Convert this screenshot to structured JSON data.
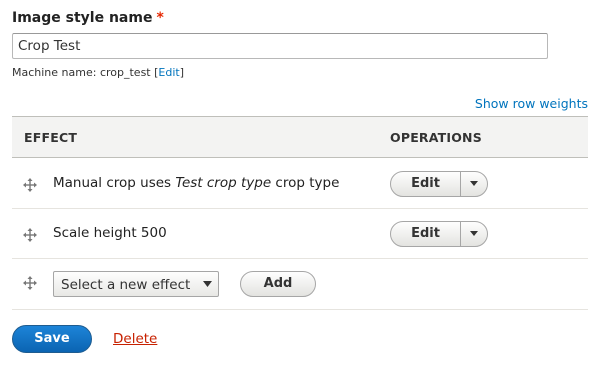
{
  "field": {
    "label": "Image style name",
    "required_mark": "*",
    "value": "Crop Test",
    "machine_name_prefix": "Machine name: crop_test [",
    "machine_name_edit": "Edit",
    "machine_name_suffix": "]"
  },
  "show_row_weights": "Show row weights",
  "table": {
    "headers": {
      "effect": "EFFECT",
      "operations": "OPERATIONS"
    },
    "rows": [
      {
        "effect_prefix": "Manual crop uses ",
        "effect_em": "Test crop type",
        "effect_suffix": " crop type",
        "operation": "Edit"
      },
      {
        "effect_prefix": "Scale height 500",
        "effect_em": "",
        "effect_suffix": "",
        "operation": "Edit"
      }
    ],
    "new_effect": {
      "selected": "Select a new effect",
      "add_label": "Add"
    }
  },
  "actions": {
    "save": "Save",
    "delete": "Delete"
  },
  "colors": {
    "link": "#0074bd",
    "primary": "#0b64b2",
    "danger": "#c72100",
    "required": "#e62600"
  },
  "icons": {
    "drag_handle": "move-arrows-icon",
    "dropdown": "chevron-down-icon"
  }
}
